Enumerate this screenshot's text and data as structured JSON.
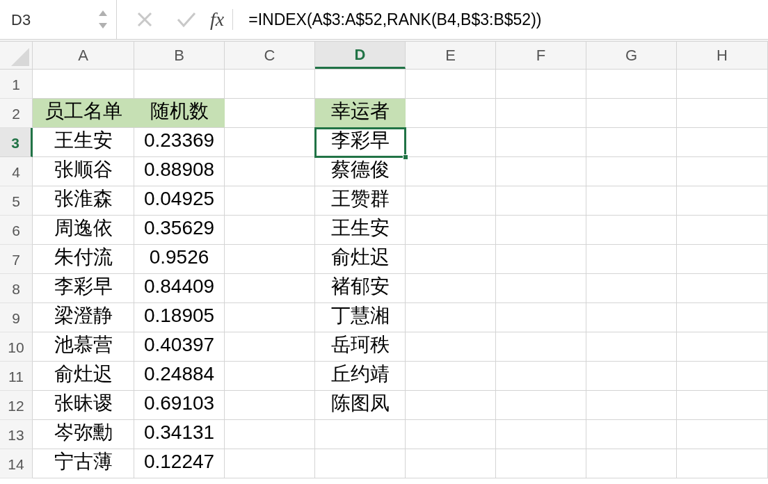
{
  "formula_bar": {
    "name_box": "D3",
    "fx": "fx",
    "formula": "=INDEX(A$3:A$52,RANK(B4,B$3:B$52))"
  },
  "columns": [
    {
      "label": "A",
      "selected": false
    },
    {
      "label": "B",
      "selected": false
    },
    {
      "label": "C",
      "selected": false
    },
    {
      "label": "D",
      "selected": true
    },
    {
      "label": "E",
      "selected": false
    },
    {
      "label": "F",
      "selected": false
    },
    {
      "label": "G",
      "selected": false
    },
    {
      "label": "H",
      "selected": false
    }
  ],
  "rows": [
    {
      "number": "1",
      "selected": false,
      "cells": [
        null,
        null,
        null,
        null,
        null,
        null,
        null,
        null
      ]
    },
    {
      "number": "2",
      "selected": false,
      "cells": [
        {
          "text": "员工名单",
          "kind": "header"
        },
        {
          "text": "随机数",
          "kind": "header"
        },
        null,
        {
          "text": "幸运者",
          "kind": "header"
        },
        null,
        null,
        null,
        null
      ]
    },
    {
      "number": "3",
      "selected": true,
      "cells": [
        {
          "text": "王生安",
          "kind": "value"
        },
        {
          "text": "0.23369",
          "kind": "value"
        },
        null,
        {
          "text": "李彩早",
          "kind": "value",
          "selected": true
        },
        null,
        null,
        null,
        null
      ]
    },
    {
      "number": "4",
      "selected": false,
      "cells": [
        {
          "text": "张顺谷",
          "kind": "value"
        },
        {
          "text": "0.88908",
          "kind": "value"
        },
        null,
        {
          "text": "蔡德俊",
          "kind": "value",
          "selected": false
        },
        null,
        null,
        null,
        null
      ]
    },
    {
      "number": "5",
      "selected": false,
      "cells": [
        {
          "text": "张淮森",
          "kind": "value"
        },
        {
          "text": "0.04925",
          "kind": "value"
        },
        null,
        {
          "text": "王赞群",
          "kind": "value",
          "selected": false
        },
        null,
        null,
        null,
        null
      ]
    },
    {
      "number": "6",
      "selected": false,
      "cells": [
        {
          "text": "周逸依",
          "kind": "value"
        },
        {
          "text": "0.35629",
          "kind": "value"
        },
        null,
        {
          "text": "王生安",
          "kind": "value",
          "selected": false
        },
        null,
        null,
        null,
        null
      ]
    },
    {
      "number": "7",
      "selected": false,
      "cells": [
        {
          "text": "朱付流",
          "kind": "value"
        },
        {
          "text": "0.9526",
          "kind": "value"
        },
        null,
        {
          "text": "俞灶迟",
          "kind": "value",
          "selected": false
        },
        null,
        null,
        null,
        null
      ]
    },
    {
      "number": "8",
      "selected": false,
      "cells": [
        {
          "text": "李彩早",
          "kind": "value"
        },
        {
          "text": "0.84409",
          "kind": "value"
        },
        null,
        {
          "text": "褚郁安",
          "kind": "value",
          "selected": false
        },
        null,
        null,
        null,
        null
      ]
    },
    {
      "number": "9",
      "selected": false,
      "cells": [
        {
          "text": "梁澄静",
          "kind": "value"
        },
        {
          "text": "0.18905",
          "kind": "value"
        },
        null,
        {
          "text": "丁慧湘",
          "kind": "value",
          "selected": false
        },
        null,
        null,
        null,
        null
      ]
    },
    {
      "number": "10",
      "selected": false,
      "cells": [
        {
          "text": "池慕营",
          "kind": "value"
        },
        {
          "text": "0.40397",
          "kind": "value"
        },
        null,
        {
          "text": "岳珂秩",
          "kind": "value",
          "selected": false
        },
        null,
        null,
        null,
        null
      ]
    },
    {
      "number": "11",
      "selected": false,
      "cells": [
        {
          "text": "俞灶迟",
          "kind": "value"
        },
        {
          "text": "0.24884",
          "kind": "value"
        },
        null,
        {
          "text": "丘约靖",
          "kind": "value",
          "selected": false
        },
        null,
        null,
        null,
        null
      ]
    },
    {
      "number": "12",
      "selected": false,
      "cells": [
        {
          "text": "张昧谡",
          "kind": "value"
        },
        {
          "text": "0.69103",
          "kind": "value"
        },
        null,
        {
          "text": "陈图凤",
          "kind": "value",
          "selected": false
        },
        null,
        null,
        null,
        null
      ]
    },
    {
      "number": "13",
      "selected": false,
      "cells": [
        {
          "text": "岑弥勳",
          "kind": "value"
        },
        {
          "text": "0.34131",
          "kind": "value"
        },
        null,
        null,
        null,
        null,
        null,
        null
      ]
    },
    {
      "number": "14",
      "selected": false,
      "cells": [
        {
          "text": "宁古薄",
          "kind": "value"
        },
        {
          "text": "0.12247",
          "kind": "value"
        },
        null,
        null,
        null,
        null,
        null,
        null
      ]
    }
  ]
}
